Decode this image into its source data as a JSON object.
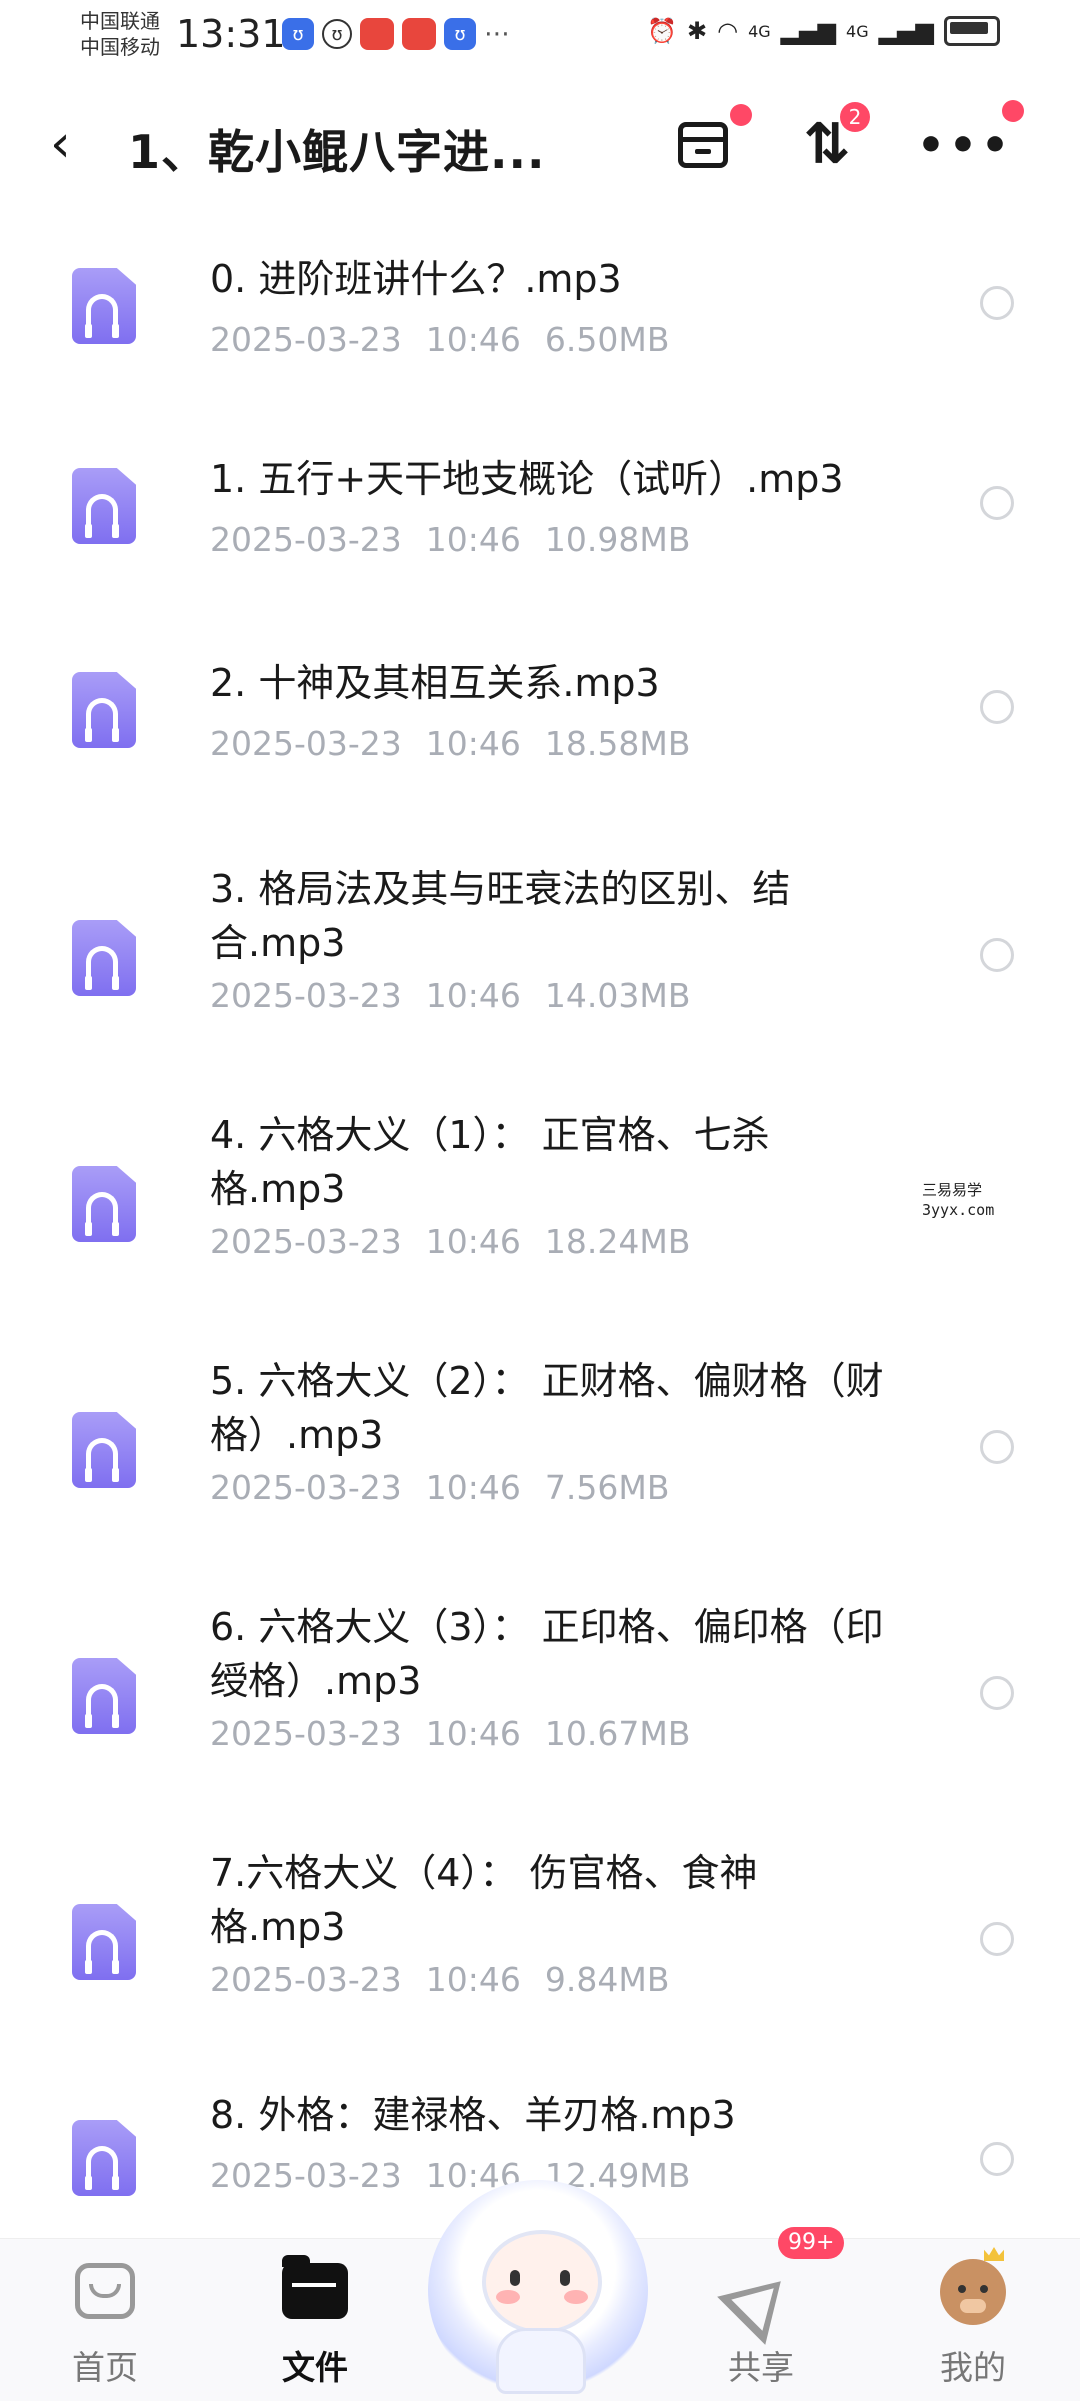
{
  "status_bar": {
    "carrier_1": "中国联通",
    "carrier_2": "中国移动",
    "time": "13:31",
    "network_1": "4G",
    "network_2": "4G"
  },
  "header": {
    "title": "1、乾小鲲八字进...",
    "sort_badge": "2"
  },
  "files": [
    {
      "name": "0. 进阶班讲什么？.mp3",
      "date": "2025-03-23",
      "time": "10:46",
      "size": "6.50MB"
    },
    {
      "name": "1. 五行+天干地支概论（试听）.mp3",
      "date": "2025-03-23",
      "time": "10:46",
      "size": "10.98MB"
    },
    {
      "name": "2. 十神及其相互关系.mp3",
      "date": "2025-03-23",
      "time": "10:46",
      "size": "18.58MB"
    },
    {
      "name": "3. 格局法及其与旺衰法的区别、结合.mp3",
      "date": "2025-03-23",
      "time": "10:46",
      "size": "14.03MB"
    },
    {
      "name": "4. 六格大义（1）： 正官格、七杀格.mp3",
      "date": "2025-03-23",
      "time": "10:46",
      "size": "18.24MB"
    },
    {
      "name": "5. 六格大义（2）： 正财格、偏财格（财格）.mp3",
      "date": "2025-03-23",
      "time": "10:46",
      "size": "7.56MB"
    },
    {
      "name": "6. 六格大义（3）： 正印格、偏印格（印绶格）.mp3",
      "date": "2025-03-23",
      "time": "10:46",
      "size": "10.67MB"
    },
    {
      "name": "7.六格大义（4）： 伤官格、食神格.mp3",
      "date": "2025-03-23",
      "time": "10:46",
      "size": "9.84MB"
    },
    {
      "name": "8. 外格：建禄格、羊刃格.mp3",
      "date": "2025-03-23",
      "time": "10:46",
      "size": "12.49MB"
    }
  ],
  "watermark": {
    "line1": "三易易学",
    "line2": "3yyx.com"
  },
  "bottom_nav": {
    "home": "首页",
    "files": "文件",
    "share": "共享",
    "share_badge": "99+",
    "me": "我的"
  }
}
